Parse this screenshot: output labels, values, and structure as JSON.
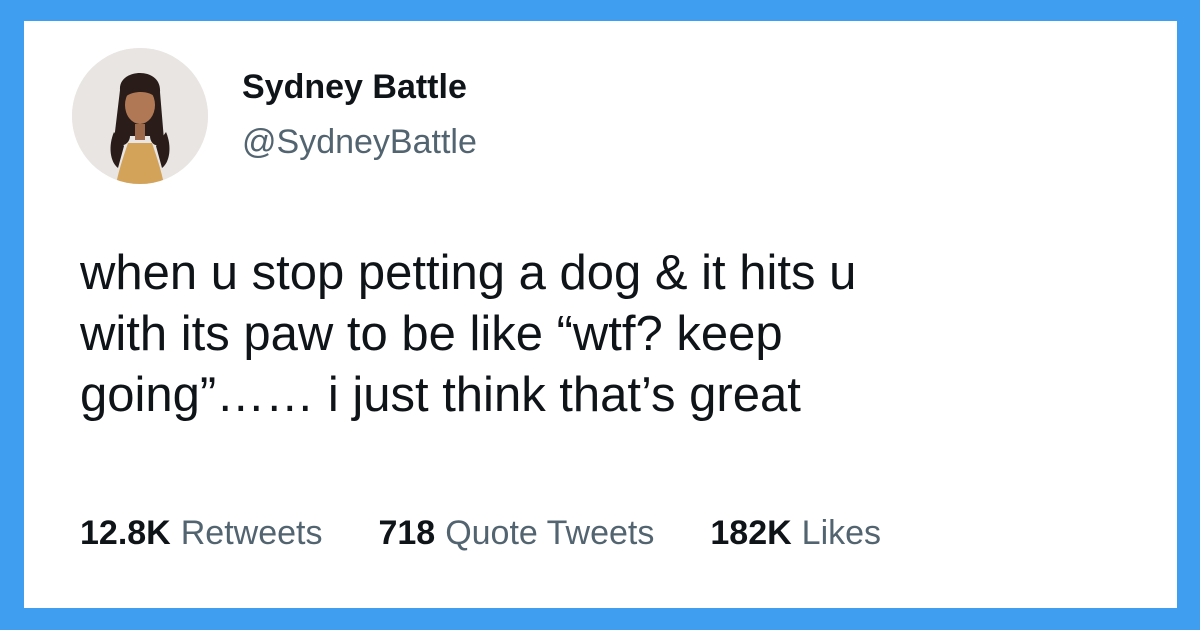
{
  "colors": {
    "frame_border": "#3f9ef0",
    "card_background": "#ffffff",
    "primary_text": "#0f1419",
    "secondary_text": "#536471"
  },
  "tweet": {
    "author": {
      "display_name": "Sydney Battle",
      "handle": "@SydneyBattle"
    },
    "text": "when u stop petting a dog & it hits u\nwith its paw to be like “wtf? keep\ngoing”…… i just think that’s great",
    "stats": [
      {
        "count": "12.8K",
        "label": "Retweets"
      },
      {
        "count": "718",
        "label": "Quote Tweets"
      },
      {
        "count": "182K",
        "label": "Likes"
      }
    ]
  }
}
